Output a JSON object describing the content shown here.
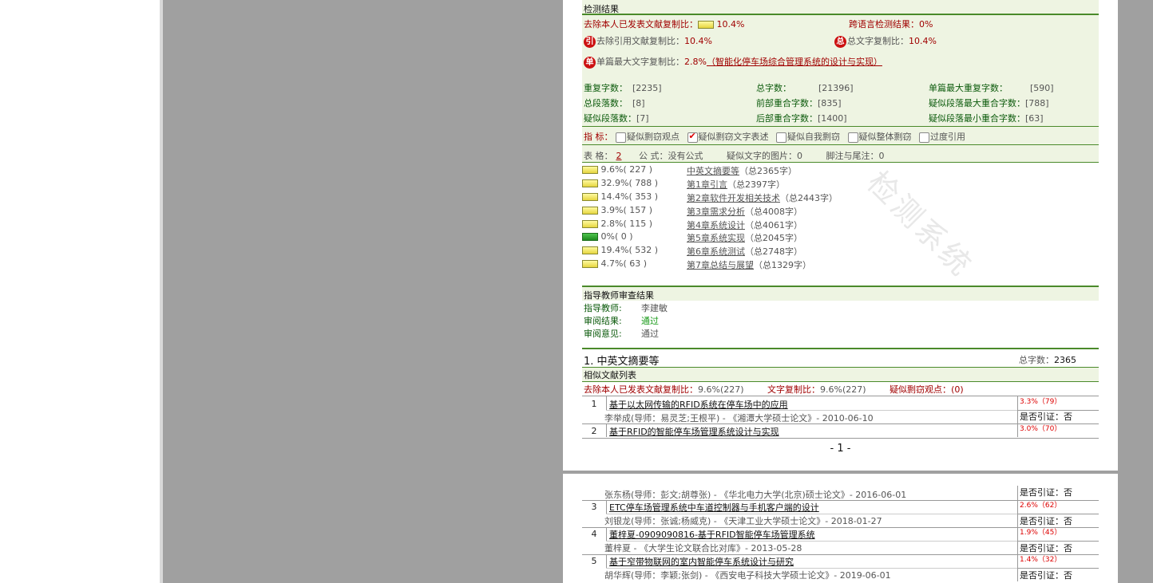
{
  "detection": {
    "section_title": "检测结果",
    "excl_self_label": "去除本人已发表文献复制比：",
    "excl_self_value": "10.4%",
    "cross_lang_label": "跨语言检测结果：",
    "cross_lang_value": "0%",
    "excl_quote_label": "去除引用文献复制比：",
    "excl_quote_value": "10.4%",
    "total_copy_label": "总文字复制比：",
    "total_copy_value": "10.4%",
    "single_max_label": "单篇最大文字复制比：",
    "single_max_value": "2.8%",
    "single_max_title": "（智能化停车场综合管理系统的设计与实现）",
    "badge_yin": "引",
    "badge_zong": "总",
    "badge_dan": "单",
    "stats": [
      {
        "label": "重复字数：",
        "value": "[2235]"
      },
      {
        "label": "总字数：",
        "value": "[21396]"
      },
      {
        "label": "单篇最大重复字数：",
        "value": "[590]"
      },
      {
        "label": "总段落数：",
        "value": "[8]"
      },
      {
        "label": "前部重合字数：",
        "value": "[835]"
      },
      {
        "label": "疑似段落最大重合字数：",
        "value": "[788]"
      },
      {
        "label": "疑似段落数：",
        "value": "[7]"
      },
      {
        "label": "后部重合字数：",
        "value": "[1400]"
      },
      {
        "label": "疑似段落最小重合字数：",
        "value": "[63]"
      }
    ],
    "indicator_label": "指 标：",
    "indicators": [
      {
        "label": "疑似剽窃观点",
        "checked": false
      },
      {
        "label": "疑似剽窃文字表述",
        "checked": true
      },
      {
        "label": "疑似自我剽窃",
        "checked": false
      },
      {
        "label": "疑似整体剽窃",
        "checked": false
      },
      {
        "label": "过度引用",
        "checked": false
      }
    ],
    "table_label": "表 格：",
    "table_value": "2",
    "formula_label": "公 式：",
    "formula_value": "没有公式",
    "images_label": "疑似文字的图片：",
    "images_value": "0",
    "footnote_label": "脚注与尾注：",
    "footnote_value": "0",
    "watermark": "检测系统"
  },
  "chapters": [
    {
      "pct": "9.6%( 227 )",
      "name": "中英文摘要等",
      "total": "（总2365字）",
      "color": "yellow"
    },
    {
      "pct": "32.9%( 788 )",
      "name": "第1章引言",
      "total": "（总2397字）",
      "color": "yellow"
    },
    {
      "pct": "14.4%( 353 )",
      "name": "第2章软件开发相关技术",
      "total": "（总2443字）",
      "color": "yellow"
    },
    {
      "pct": "3.9%( 157 )",
      "name": "第3章需求分析",
      "total": "（总4008字）",
      "color": "yellow"
    },
    {
      "pct": "2.8%( 115 )",
      "name": "第4章系统设计",
      "total": "（总4061字）",
      "color": "yellow"
    },
    {
      "pct": "0%( 0 )",
      "name": "第5章系统实现",
      "total": "（总2045字）",
      "color": "green"
    },
    {
      "pct": "19.4%( 532 )",
      "name": "第6章系统测试",
      "total": "（总2748字）",
      "color": "yellow"
    },
    {
      "pct": "4.7%( 63 )",
      "name": "第7章总结与展望",
      "total": "（总1329字）",
      "color": "yellow"
    }
  ],
  "review": {
    "title": "指导教师审查结果",
    "teacher_label": "指导教师:",
    "teacher_value": "李建敏",
    "result_label": "审阅结果:",
    "result_value": "通过",
    "opinion_label": "审阅意见:",
    "opinion_value": "通过"
  },
  "section1": {
    "title": "1. 中英文摘要等",
    "total_label": "总字数：",
    "total_value": "2365",
    "list_title": "相似文献列表",
    "excl_label": "去除本人已发表文献复制比：",
    "excl_value": "9.6%(227)",
    "text_label": "文字复制比：",
    "text_value": "9.6%(227)",
    "viewpoint_label": "疑似剽窃观点：",
    "viewpoint_value": "(0)"
  },
  "refs_page1": [
    {
      "num": "1",
      "title": "基于以太网传输的RFID系统在停车场中的应用",
      "pct": "3.3%（79）",
      "meta": "李举成(导师：易灵芝;王根平) - 《湘潭大学硕士论文》- 2010-06-10",
      "cite": "是否引证：否"
    },
    {
      "num": "2",
      "title": "基于RFID的智能停车场管理系统设计与实现",
      "pct": "3.0%（70）"
    }
  ],
  "page_number": "- 1 -",
  "refs_page2": {
    "first_meta": "张东杨(导师：彭文;胡尊张) - 《华北电力大学(北京)硕士论文》- 2016-06-01",
    "first_cite": "是否引证：否",
    "items": [
      {
        "num": "3",
        "title": "ETC停车场管理系统中车道控制器与手机客户端的设计",
        "pct": "2.6%（62）",
        "meta": "刘银龙(导师：张诚;杨威克) - 《天津工业大学硕士论文》- 2018-01-27",
        "cite": "是否引证：否"
      },
      {
        "num": "4",
        "title": "董梓夏-0909090816-基于RFID智能停车场管理系统",
        "pct": "1.9%（45）",
        "meta": "董梓夏 - 《大学生论文联合比对库》- 2013-05-28",
        "cite": "是否引证：否"
      },
      {
        "num": "5",
        "title": "基于窄带物联网的室内智能停车系统设计与研究",
        "pct": "1.4%（32）",
        "meta": "胡华辉(导师：李颖;张剑) - 《西安电子科技大学硕士论文》- 2019-06-01",
        "cite": "是否引证：否"
      }
    ]
  },
  "colors": {
    "accent_green": "#4a8a2a",
    "label_red": "#a00000",
    "label_green": "#0b5a0b",
    "viewer_gray": "#a0a0a0"
  }
}
